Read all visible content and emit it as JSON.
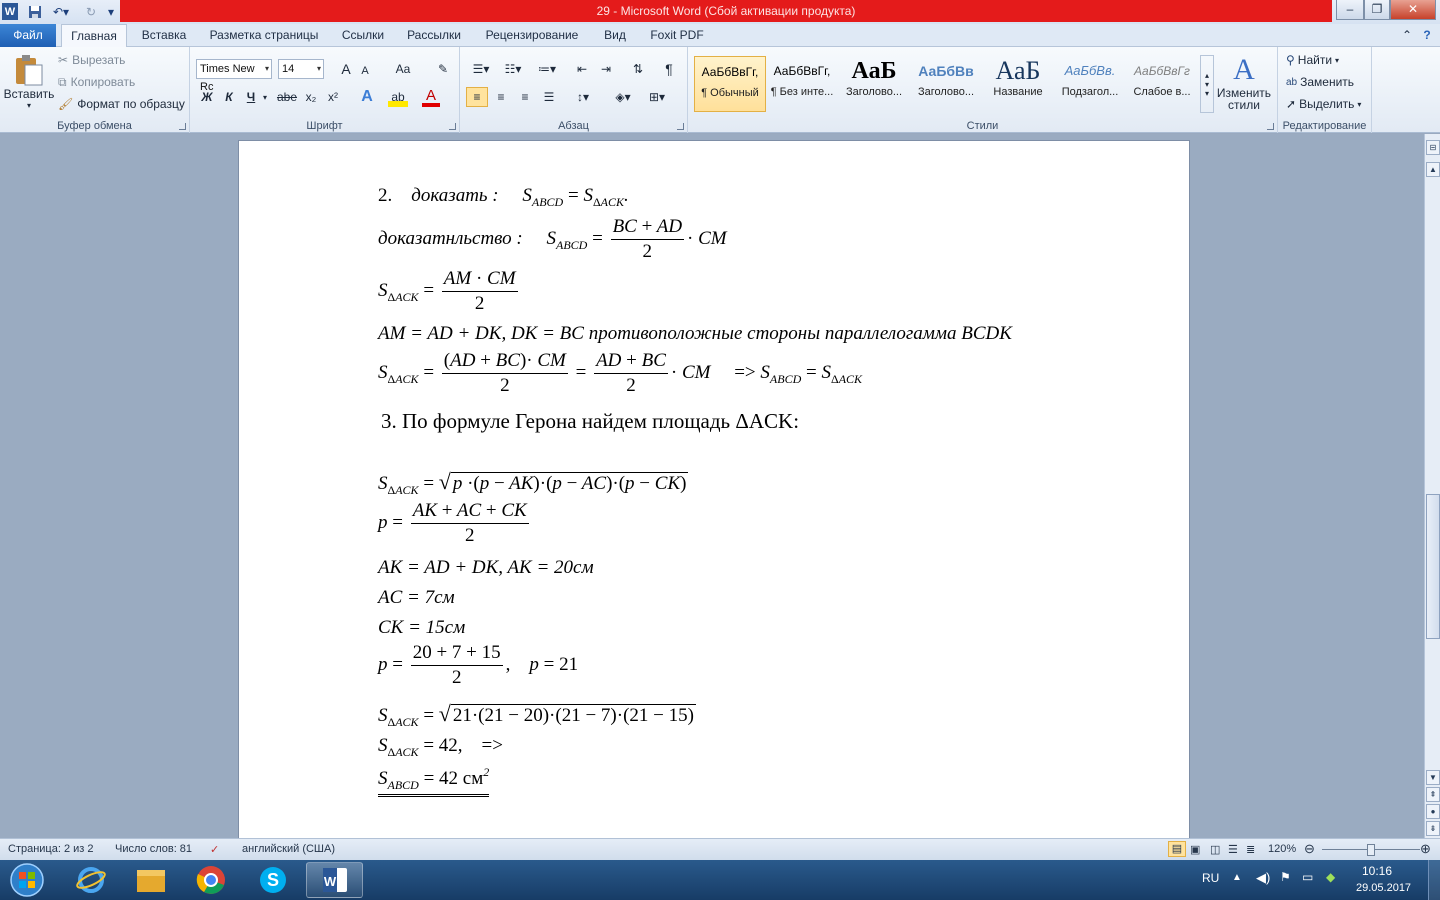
{
  "titlebar": {
    "title": "29  -  Microsoft Word (Сбой активации продукта)",
    "minimize": "–",
    "restore": "❐",
    "close": "✕"
  },
  "tabs": {
    "file": "Файл",
    "items": [
      "Главная",
      "Вставка",
      "Разметка страницы",
      "Ссылки",
      "Рассылки",
      "Рецензирование",
      "Вид",
      "Foxit PDF"
    ]
  },
  "clipboard": {
    "paste": "Вставить",
    "cut": "Вырезать",
    "copy": "Копировать",
    "format_painter": "Формат по образцу",
    "label": "Буфер обмена"
  },
  "font": {
    "family": "Times New Rc",
    "size": "14",
    "label": "Шрифт",
    "bold": "Ж",
    "italic": "К",
    "underline": "Ч",
    "strike": "abe",
    "subscript": "x₂",
    "superscript": "x²",
    "grow": "A",
    "shrink": "A",
    "case": "Aa",
    "text_effect": "A",
    "highlight": "ab",
    "color": "A"
  },
  "paragraph": {
    "label": "Абзац",
    "pilcrow": "¶"
  },
  "styles": {
    "label": "Стили",
    "items": [
      {
        "preview": "АаБбВвГг,",
        "name": "¶ Обычный"
      },
      {
        "preview": "АаБбВвГг,",
        "name": "¶ Без инте..."
      },
      {
        "preview": "АаБ",
        "name": "Заголово..."
      },
      {
        "preview": "АаБбВв",
        "name": "Заголово..."
      },
      {
        "preview": "АаБ",
        "name": "Название"
      },
      {
        "preview": "АаБбВв.",
        "name": "Подзагол..."
      },
      {
        "preview": "АаБбВвГг",
        "name": "Слабое в..."
      }
    ],
    "change": "Изменить стили"
  },
  "editing": {
    "label": "Редактирование",
    "find": "Найти",
    "replace": "Заменить",
    "select": "Выделить"
  },
  "doc": {
    "l1_num": "2.",
    "l1_word": "доказать :",
    "l2_word": "доказатнльство :",
    "l4": "AM = AD + DK,    DK = BC противоположные стороны параллелогамма BCDK",
    "l6": "3.  По формуле Герона найдем площадь ΔACK:",
    "l9": "AK = AD + DK,    AK = 20см",
    "l10": "AC = 7см",
    "l11": "CK = 15см",
    "l14": "S",
    "l15_result": "= 42 см"
  },
  "status": {
    "page": "Страница: 2 из 2",
    "words": "Число слов: 81",
    "language": "английский (США)",
    "zoom": "120%"
  },
  "taskbar": {
    "lang": "RU",
    "time": "10:16",
    "date": "29.05.2017"
  }
}
